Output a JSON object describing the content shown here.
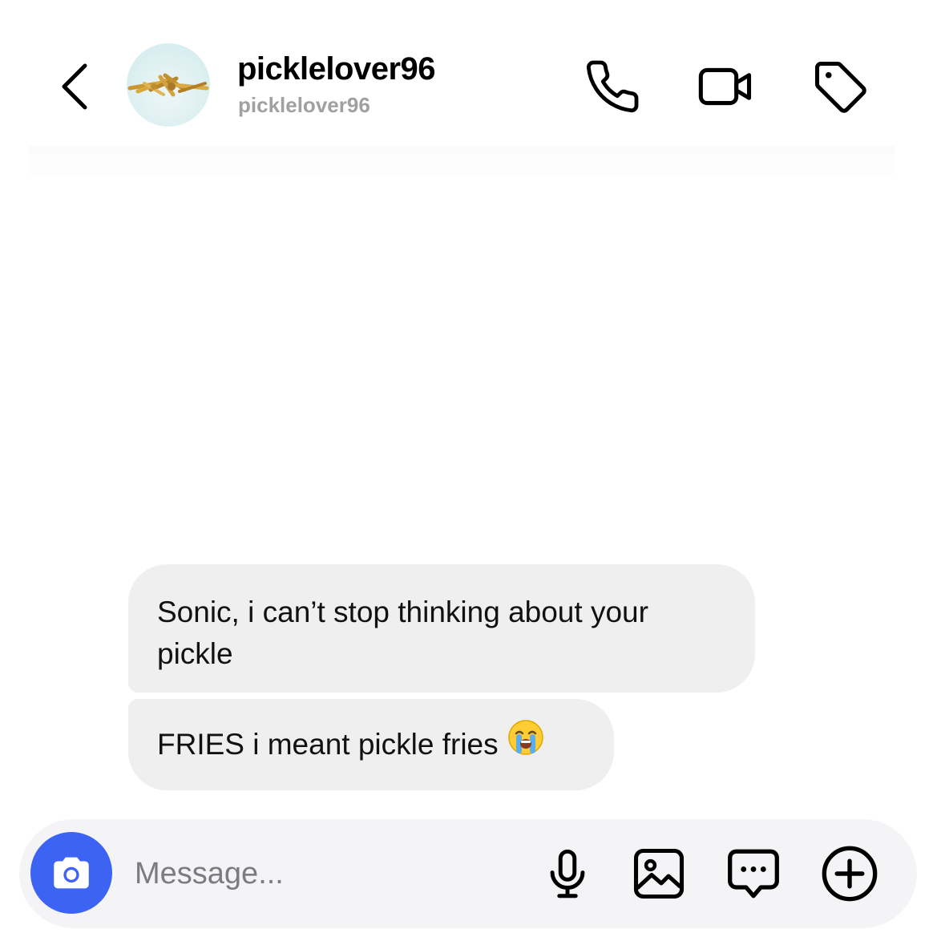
{
  "header": {
    "display_name": "picklelover96",
    "username": "picklelover96",
    "back_icon": "chevron-left-icon",
    "actions": {
      "call_icon": "phone-icon",
      "video_icon": "video-camera-icon",
      "tag_icon": "tag-icon"
    }
  },
  "messages": [
    {
      "text": "Sonic, i can’t stop thinking about your pickle",
      "from": "other"
    },
    {
      "text": "FRIES i meant pickle fries",
      "emoji": "loudly-crying-face",
      "from": "other"
    }
  ],
  "composer": {
    "placeholder": "Message...",
    "camera_icon": "camera-icon",
    "mic_icon": "microphone-icon",
    "gallery_icon": "image-icon",
    "sticker_icon": "chat-bubble-ellipsis-icon",
    "add_icon": "plus-circle-icon"
  },
  "colors": {
    "bubble_bg": "#efeff0",
    "camera_button": "#3c63f2",
    "username_gray": "#a0a0a0",
    "composer_bg": "#f4f4f6"
  }
}
